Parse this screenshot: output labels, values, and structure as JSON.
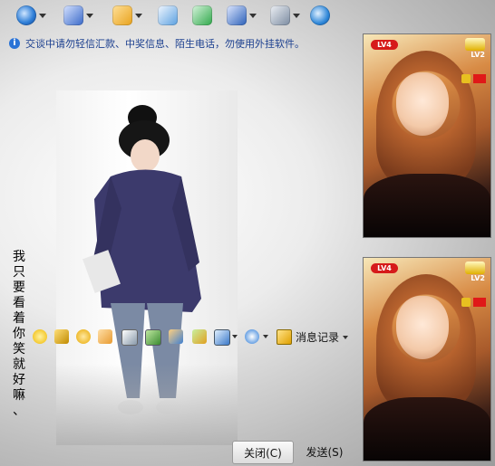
{
  "toolbar": {
    "buttons": [
      {
        "name": "video-call-icon",
        "color": "#2f7fd8"
      },
      {
        "name": "microphone-icon",
        "color": "#3868c8"
      },
      {
        "name": "folder-transfer-icon",
        "color": "#e8a21c"
      },
      {
        "name": "mail-icon",
        "color": "#5aa0e0"
      },
      {
        "name": "add-contact-icon",
        "color": "#2fa84a"
      },
      {
        "name": "remote-assist-icon",
        "color": "#2a5fb8"
      },
      {
        "name": "settings-icon",
        "color": "#7a8aa0"
      },
      {
        "name": "app-launch-icon",
        "color": "#2d86d8"
      }
    ]
  },
  "notice": {
    "text": "交谈中请勿轻信汇款、中奖信息、陌生电话，勿使用外挂软件。"
  },
  "side_text": [
    "我",
    "只",
    "要",
    "看",
    "着",
    "你",
    "笑",
    "就",
    "好",
    "嘛",
    "、"
  ],
  "emoji_bar": {
    "icons": [
      "emoticon-icon",
      "magic-emoticon-icon",
      "wink-icon",
      "hand-icon",
      "screenshot-icon",
      "image-icon",
      "music-icon",
      "gift-icon",
      "screen-capture-icon",
      "payment-icon"
    ],
    "history_label": "消息记录"
  },
  "video": {
    "remote_level": "LV4",
    "remote_level2": "LV2",
    "local_level": "LV4",
    "local_level2": "LV2"
  },
  "buttons": {
    "close_label": "关闭(C)",
    "send_label": "发送(S)"
  }
}
